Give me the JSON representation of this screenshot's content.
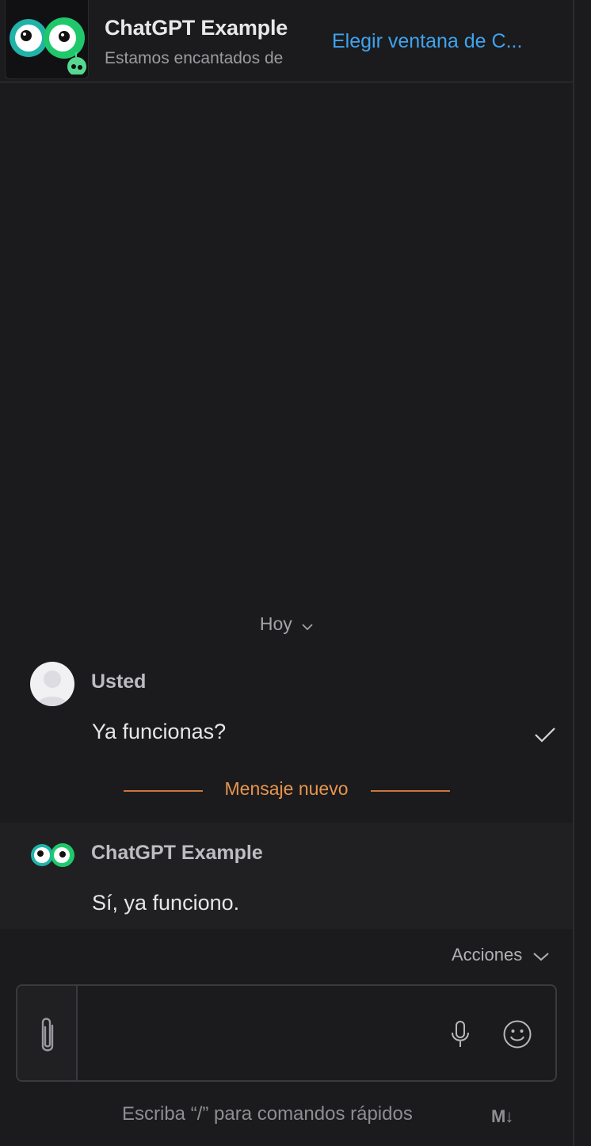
{
  "header": {
    "title": "ChatGPT Example",
    "subtitle": "Estamos encantados de",
    "choose_window_link": "Elegir ventana de C..."
  },
  "conversation": {
    "day_label": "Hoy",
    "messages": [
      {
        "sender": "Usted",
        "text": "Ya funcionas?",
        "status_icon": "check-icon"
      },
      {
        "sender": "ChatGPT Example",
        "text": "Sí, ya funciono."
      }
    ],
    "new_message_divider": "Mensaje nuevo"
  },
  "composer": {
    "actions_label": "Acciones",
    "hint": "Escriba “/” para comandos rápidos",
    "markdown_badge": "M↓",
    "icons": [
      "paperclip-icon",
      "microphone-icon",
      "emoji-icon"
    ]
  },
  "colors": {
    "background": "#1b1b1d",
    "link": "#3fa3ef",
    "new_message": "#e8954f",
    "brand_green": "#1fc96b",
    "brand_teal": "#20b3a8"
  }
}
